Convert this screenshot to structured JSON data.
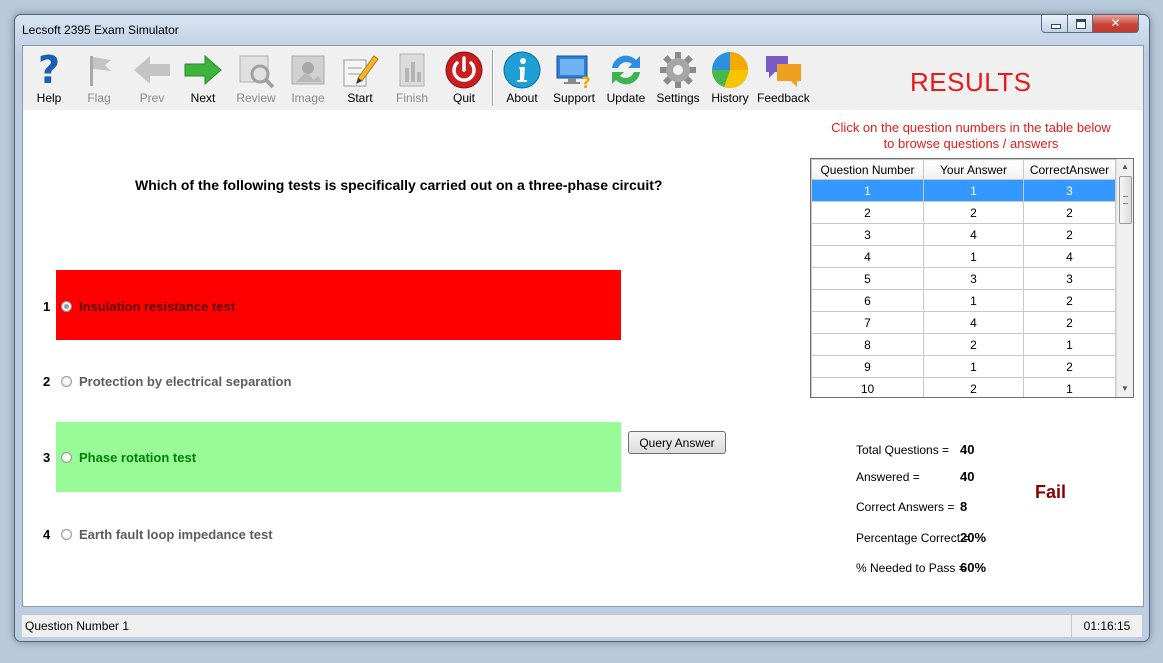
{
  "window": {
    "title": "Lecsoft 2395 Exam Simulator"
  },
  "toolbar": {
    "help": "Help",
    "flag": "Flag",
    "prev": "Prev",
    "next": "Next",
    "review": "Review",
    "image": "Image",
    "start": "Start",
    "finish": "Finish",
    "quit": "Quit",
    "about": "About",
    "support": "Support",
    "update": "Update",
    "settings": "Settings",
    "history": "History",
    "feedback": "Feedback"
  },
  "results": {
    "heading": "RESULTS",
    "hint_line1": "Click on the question numbers in the table below",
    "hint_line2": "to browse questions / answers",
    "columns": [
      "Question Number",
      "Your Answer",
      "CorrectAnswer"
    ],
    "rows": [
      [
        "1",
        "1",
        "3"
      ],
      [
        "2",
        "2",
        "2"
      ],
      [
        "3",
        "4",
        "2"
      ],
      [
        "4",
        "1",
        "4"
      ],
      [
        "5",
        "3",
        "3"
      ],
      [
        "6",
        "1",
        "2"
      ],
      [
        "7",
        "4",
        "2"
      ],
      [
        "8",
        "2",
        "1"
      ],
      [
        "9",
        "1",
        "2"
      ],
      [
        "10",
        "2",
        "1"
      ]
    ],
    "selected_row": 0
  },
  "question": {
    "text": "Which of the following tests is specifically carried out on a three-phase circuit?",
    "options": [
      {
        "number": "1",
        "text": "Insulation resistance test",
        "selected": true,
        "highlight": "#ff0000"
      },
      {
        "number": "2",
        "text": "Protection by electrical separation",
        "selected": false
      },
      {
        "number": "3",
        "text": "Phase rotation test",
        "selected": false,
        "highlight": "#98fb98",
        "text_color": "#008000"
      },
      {
        "number": "4",
        "text": "Earth fault loop impedance test",
        "selected": false
      }
    ],
    "query_button": "Query Answer"
  },
  "stats": {
    "total_label": "Total Questions =",
    "total_value": "40",
    "answered_label": "Answered =",
    "answered_value": "40",
    "correct_label": "Correct Answers =",
    "correct_value": "8",
    "percent_label": "Percentage Correct =",
    "percent_value": "20%",
    "needed_label": "% Needed to Pass =",
    "needed_value": "60%",
    "outcome": "Fail"
  },
  "status": {
    "question_number": "Question Number 1",
    "timer": "01:16:15"
  },
  "colors": {
    "accent_red": "#e51b1b",
    "fail": "#8b0000",
    "selection": "#3399ff"
  }
}
